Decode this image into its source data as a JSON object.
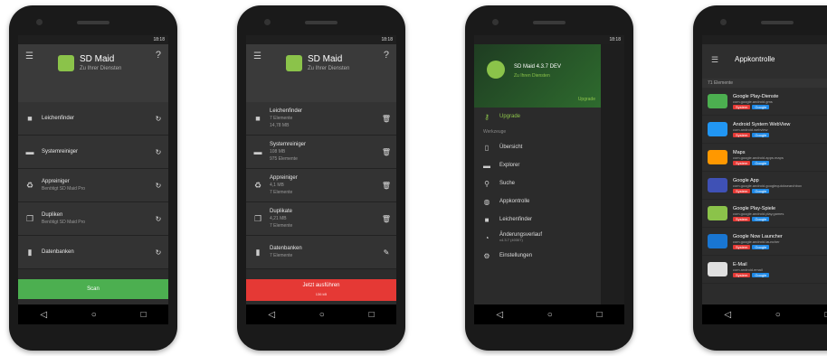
{
  "status_bar": {
    "time": "18:18"
  },
  "phone1": {
    "app_name": "SD Maid",
    "app_sub": "Zu Ihrer Diensten",
    "rows": [
      {
        "label": "Leichenfinder",
        "sub": ""
      },
      {
        "label": "Systemreiniger",
        "sub": ""
      },
      {
        "label": "Appreiniger",
        "sub": "Benötigt SD Maid Pro"
      },
      {
        "label": "Dupliken",
        "sub": "Benötigt SD Maid Pro"
      },
      {
        "label": "Datenbanken",
        "sub": ""
      }
    ],
    "button": "Scan"
  },
  "phone2": {
    "app_name": "SD Maid",
    "app_sub": "Zu Ihrer Diensten",
    "rows": [
      {
        "label": "Leichenfinder",
        "sub": "7 Elemente",
        "sub2": "14,78 MB"
      },
      {
        "label": "Systemreiniger",
        "sub": "108 MB",
        "sub2": "975 Elemente"
      },
      {
        "label": "Appreiniger",
        "sub": "4,1 MB",
        "sub2": "7 Elemente"
      },
      {
        "label": "Duplikate",
        "sub": "4,21 MB",
        "sub2": "7 Elemente"
      },
      {
        "label": "Datenbanken",
        "sub": "7 Elemente",
        "sub2": ""
      }
    ],
    "button": "Jetzt ausführen",
    "button_sub": "136 kB"
  },
  "phone3": {
    "drawer_title": "SD Maid 4.3.7 DEV",
    "drawer_sub": "Zu Ihren Diensten",
    "upgrade": "Upgrade",
    "section": "Werkzeuge",
    "items": [
      {
        "label": "Upgrade",
        "icon": "key-icon"
      },
      {
        "label": "Übersicht",
        "icon": "phone-icon"
      },
      {
        "label": "Explorer",
        "icon": "folder-icon"
      },
      {
        "label": "Suche",
        "icon": "search-icon"
      },
      {
        "label": "Appkontrolle",
        "icon": "android-icon"
      },
      {
        "label": "Leichenfinder",
        "icon": "trash-icon"
      },
      {
        "label": "Änderungsverlauf",
        "icon": "history-icon",
        "sub": "v4.3.7 (40307)"
      },
      {
        "label": "Einstellungen",
        "icon": "gear-icon"
      }
    ]
  },
  "phone4": {
    "title": "Appkontrolle",
    "count": "71 Elemente",
    "apps": [
      {
        "name": "Google Play-Dienste",
        "pkg": "com.google.android.gms",
        "color": "#4caf50"
      },
      {
        "name": "Android System WebView",
        "pkg": "com.android.webview",
        "color": "#2196f3"
      },
      {
        "name": "Maps",
        "pkg": "com.google.android.apps.maps",
        "color": "#ff9800"
      },
      {
        "name": "Google App",
        "pkg": "com.google.android.googlequicksearchbox",
        "color": "#3f51b5"
      },
      {
        "name": "Google Play-Spiele",
        "pkg": "com.google.android.play.games",
        "color": "#8bc34a"
      },
      {
        "name": "Google Now Launcher",
        "pkg": "com.google.android.launcher",
        "color": "#1976d2"
      },
      {
        "name": "E-Mail",
        "pkg": "com.android.email",
        "color": "#e0e0e0"
      }
    ],
    "tag_system": "System",
    "tag_google": "Google"
  }
}
